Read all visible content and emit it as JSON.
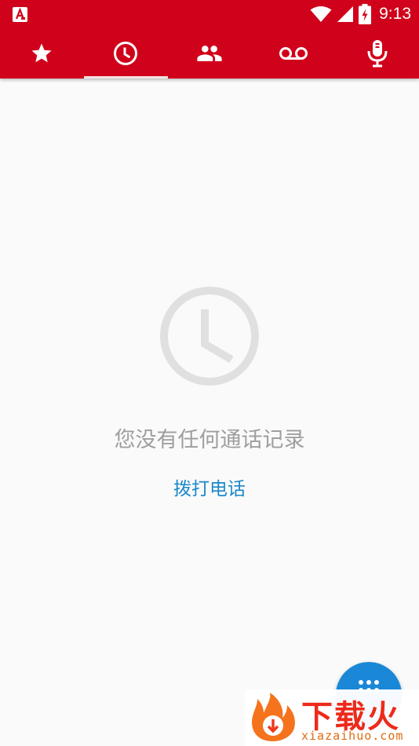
{
  "status_bar": {
    "app_icon": "a-notification-icon",
    "icons": [
      "wifi-icon",
      "signal-icon",
      "battery-charging-icon"
    ],
    "time": "9:13"
  },
  "tabs": [
    {
      "icon": "star-icon",
      "selected": false
    },
    {
      "icon": "clock-icon",
      "selected": true
    },
    {
      "icon": "contacts-icon",
      "selected": false
    },
    {
      "icon": "voicemail-icon",
      "selected": false
    },
    {
      "icon": "microphone-icon",
      "selected": false
    }
  ],
  "empty_state": {
    "icon": "clock-icon",
    "message": "您没有任何通话记录",
    "action": "拨打电话"
  },
  "fab": {
    "icon": "dialpad-icon"
  },
  "watermark": {
    "name": "下载火",
    "domain": "xiazaihuo.com"
  },
  "colors": {
    "app_bar": "#d0021b",
    "background": "#fafafa",
    "accent": "#1a88c9",
    "fab": "#1a88d6",
    "empty_text": "#9e9e9e",
    "empty_icon": "#e0e0e0"
  }
}
